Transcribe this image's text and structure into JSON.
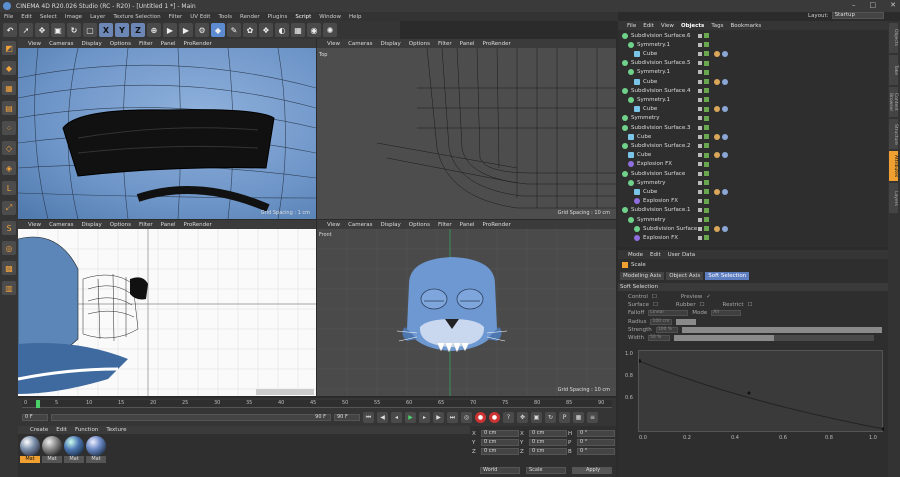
{
  "title": "CINEMA 4D R20.026 Studio (RC - R20) - [Untitled 1 *] - Main",
  "menu": [
    "File",
    "Edit",
    "Select",
    "Image",
    "Layer",
    "Texture Selection",
    "Filter",
    "UV Edit",
    "Tools",
    "Render",
    "Plugins",
    "Script",
    "Window",
    "Help"
  ],
  "menu_active": "Script",
  "layout_label": "Layout:",
  "layout_value": "Startup",
  "toolbar": {
    "x": "X",
    "y": "Y",
    "z": "Z"
  },
  "viewport_menu": [
    "View",
    "Cameras",
    "Display",
    "Options",
    "Filter",
    "Panel",
    "ProRender"
  ],
  "viewports": {
    "top": "Top",
    "right": "Right",
    "front": "Front",
    "grid_10": "Grid Spacing : 10 cm",
    "grid_1": "Grid Spacing : 1 cm"
  },
  "timeline": {
    "ticks": [
      "0",
      "5",
      "10",
      "15",
      "20",
      "25",
      "30",
      "35",
      "40",
      "45",
      "50",
      "55",
      "60",
      "65",
      "70",
      "75",
      "80",
      "85",
      "90"
    ],
    "start": "0 F",
    "current": "0 F",
    "end": "90 F",
    "end2": "90 F",
    "frame": "0 F"
  },
  "materials": {
    "menu": [
      "Create",
      "Edit",
      "Function",
      "Texture"
    ],
    "items": [
      "Mat",
      "Mat",
      "Mat",
      "Mat"
    ]
  },
  "coords": {
    "pos_label": "Position",
    "size_label": "Size",
    "rot_label": "Rotation",
    "x": "X",
    "y": "Y",
    "z": "Z",
    "h": "H",
    "p": "P",
    "b": "B",
    "val": "0 cm",
    "ang": "0 °",
    "world": "World",
    "scale": "Scale",
    "apply": "Apply"
  },
  "objmgr": {
    "menu": [
      "File",
      "Edit",
      "View",
      "Objects",
      "Tags",
      "Bookmarks"
    ],
    "active": "Objects",
    "rows": [
      {
        "name": "Subdivision Surface.6",
        "indent": 0,
        "type": "sub"
      },
      {
        "name": "Symmetry.1",
        "indent": 1,
        "type": "sub"
      },
      {
        "name": "Cube",
        "indent": 2,
        "type": "cube"
      },
      {
        "name": "Subdivision Surface.5",
        "indent": 0,
        "type": "sub"
      },
      {
        "name": "Symmetry.1",
        "indent": 1,
        "type": "sub"
      },
      {
        "name": "Cube",
        "indent": 2,
        "type": "cube"
      },
      {
        "name": "Subdivision Surface.4",
        "indent": 0,
        "type": "sub"
      },
      {
        "name": "Symmetry.1",
        "indent": 1,
        "type": "sub"
      },
      {
        "name": "Cube",
        "indent": 2,
        "type": "cube"
      },
      {
        "name": "Symmetry",
        "indent": 0,
        "type": "sub"
      },
      {
        "name": "Subdivision Surface.3",
        "indent": 0,
        "type": "sub"
      },
      {
        "name": "Cube",
        "indent": 1,
        "type": "cube"
      },
      {
        "name": "Subdivision Surface.2",
        "indent": 0,
        "type": "sub"
      },
      {
        "name": "Cube",
        "indent": 1,
        "type": "cube"
      },
      {
        "name": "Explosion FX",
        "indent": 1,
        "type": "fx"
      },
      {
        "name": "Subdivision Surface",
        "indent": 0,
        "type": "sub"
      },
      {
        "name": "Symmetry",
        "indent": 1,
        "type": "sub"
      },
      {
        "name": "Cube",
        "indent": 2,
        "type": "cube"
      },
      {
        "name": "Explosion FX",
        "indent": 2,
        "type": "fx"
      },
      {
        "name": "Subdivision Surface.1",
        "indent": 0,
        "type": "sub"
      },
      {
        "name": "Symmetry",
        "indent": 1,
        "type": "sub"
      },
      {
        "name": "Subdivision Surface",
        "indent": 2,
        "type": "sub"
      },
      {
        "name": "Explosion FX",
        "indent": 2,
        "type": "fx"
      }
    ]
  },
  "attr": {
    "menu": [
      "Mode",
      "Edit",
      "User Data"
    ],
    "object": "Scale",
    "tabs": [
      "Modeling Axis",
      "Object Axis",
      "Soft Selection"
    ],
    "active_tab": "Soft Selection",
    "section": "Soft Selection",
    "control": "Control",
    "preview": "Preview",
    "surface": "Surface",
    "rubber": "Rubber",
    "restrict": "Restrict",
    "falloff": "Falloff",
    "falloff_val": "Linear",
    "mode": "Mode",
    "mode_val": "All",
    "radius": "Radius",
    "radius_val": "100 cm",
    "strength": "Strength",
    "strength_val": "100 %",
    "width": "Width",
    "width_val": "50 %",
    "strength_pct": 1.0,
    "width_pct": 0.5,
    "graph_y": [
      "1.0",
      "0.8",
      "0.6"
    ],
    "graph_x": [
      "0.0",
      "0.2",
      "0.4",
      "0.6",
      "0.8",
      "1.0"
    ]
  },
  "side_tabs": [
    "Objects",
    "Take",
    "Content Browser",
    "Structure",
    "Attributes",
    "Layers"
  ]
}
